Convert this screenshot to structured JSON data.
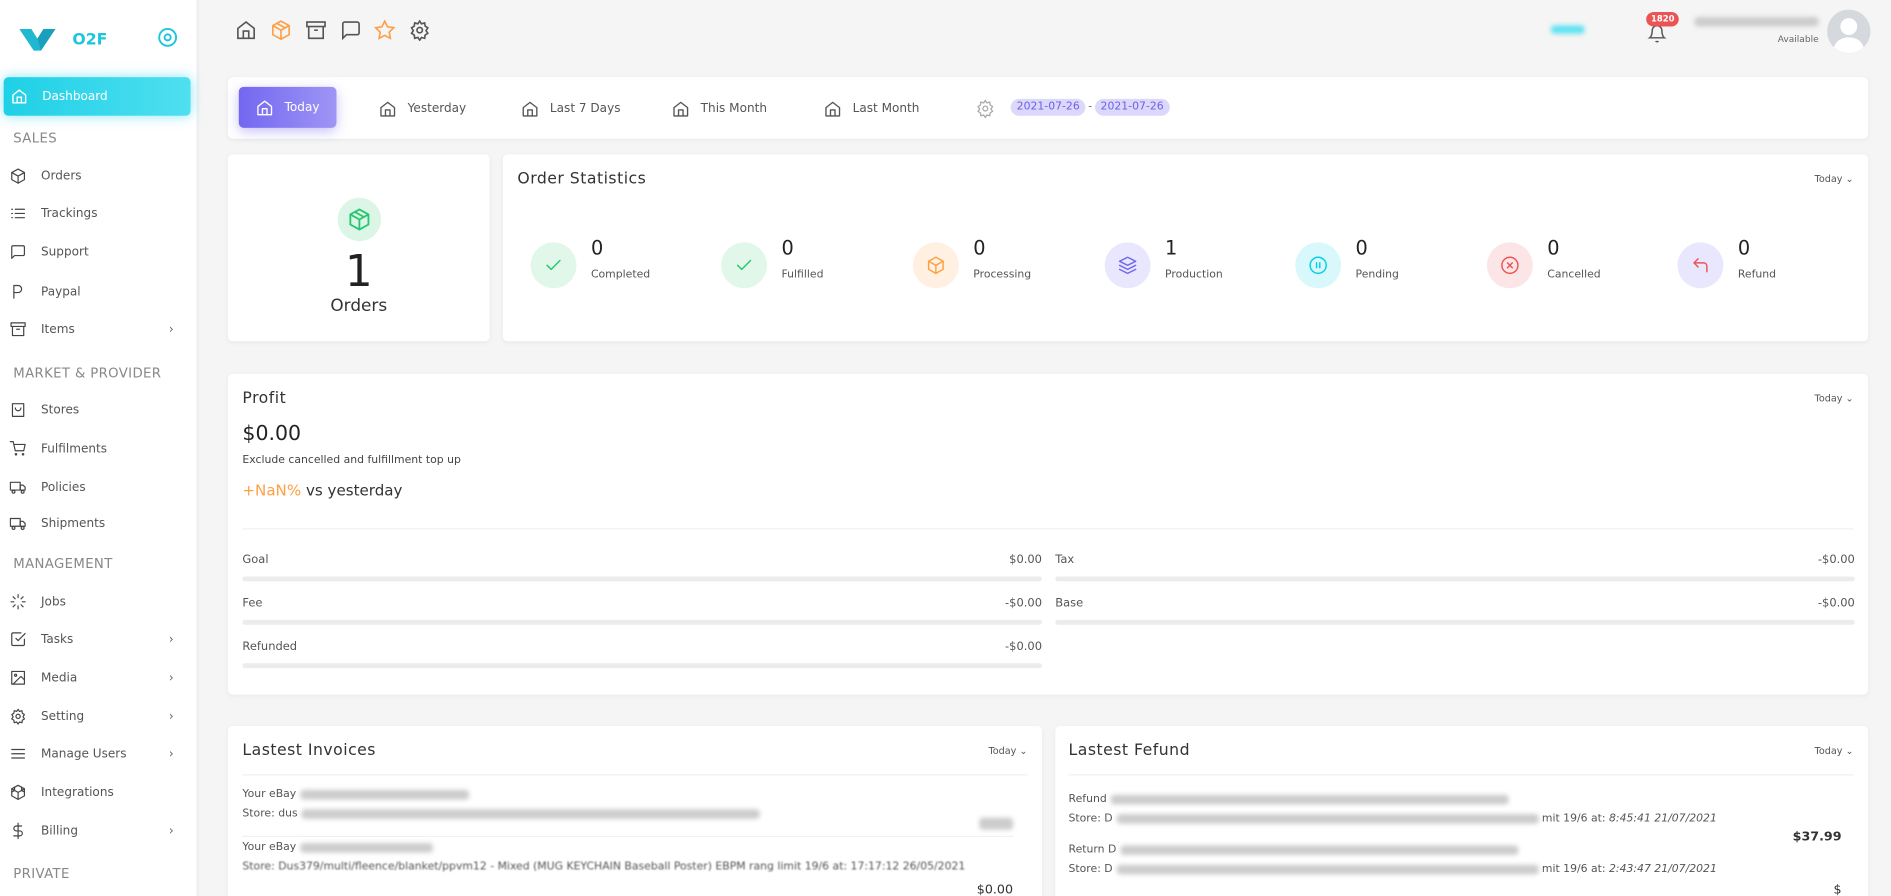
{
  "brand": {
    "name": "O2F",
    "color": "#1ec6dc"
  },
  "sidebar": {
    "active": {
      "label": "Dashboard",
      "icon": "home-icon"
    },
    "sections": [
      {
        "title": "SALES",
        "items": [
          {
            "label": "Orders",
            "icon": "box-icon",
            "chevron": false
          },
          {
            "label": "Trackings",
            "icon": "list-icon",
            "chevron": false
          },
          {
            "label": "Support",
            "icon": "message-icon",
            "chevron": false
          },
          {
            "label": "Paypal",
            "icon": "paypal-icon",
            "chevron": false
          },
          {
            "label": "Items",
            "icon": "archive-icon",
            "chevron": true
          }
        ]
      },
      {
        "title": "MARKET & PROVIDER",
        "items": [
          {
            "label": "Stores",
            "icon": "shopping-bag-icon",
            "chevron": false
          },
          {
            "label": "Fulfilments",
            "icon": "cart-icon",
            "chevron": false
          },
          {
            "label": "Policies",
            "icon": "truck-icon",
            "chevron": false
          },
          {
            "label": "Shipments",
            "icon": "truck-icon",
            "chevron": false
          }
        ]
      },
      {
        "title": "MANAGEMENT",
        "items": [
          {
            "label": "Jobs",
            "icon": "loader-icon",
            "chevron": false
          },
          {
            "label": "Tasks",
            "icon": "check-square-icon",
            "chevron": true
          },
          {
            "label": "Media",
            "icon": "image-icon",
            "chevron": true
          },
          {
            "label": "Setting",
            "icon": "gear-icon",
            "chevron": true
          },
          {
            "label": "Manage Users",
            "icon": "menu-icon",
            "chevron": true
          },
          {
            "label": "Integrations",
            "icon": "codesandbox-icon",
            "chevron": false
          },
          {
            "label": "Billing",
            "icon": "dollar-icon",
            "chevron": true
          }
        ]
      },
      {
        "title": "PRIVATE",
        "items": []
      }
    ]
  },
  "header": {
    "icons": [
      "home-icon",
      "box-icon",
      "archive-icon",
      "message-icon",
      "star-icon",
      "gear-icon"
    ],
    "notification_count": "1820",
    "user_status": "Available"
  },
  "filters": {
    "items": [
      "Today",
      "Yesterday",
      "Last 7 Days",
      "This Month",
      "Last Month"
    ],
    "date_from": "2021-07-26",
    "date_sep": "-",
    "date_to": "2021-07-26",
    "accent": "#7367f0"
  },
  "orders_card": {
    "count": "1",
    "label": "Orders"
  },
  "order_statistics": {
    "title": "Order Statistics",
    "period": "Today ⌄",
    "stats": [
      {
        "value": "0",
        "label": "Completed",
        "icon": "check-icon",
        "color": "#28c76f",
        "bg": "#e0f7ea"
      },
      {
        "value": "0",
        "label": "Fulfilled",
        "icon": "check-icon",
        "color": "#28c76f",
        "bg": "#e0f7ea"
      },
      {
        "value": "0",
        "label": "Processing",
        "icon": "box-icon",
        "color": "#ff9f43",
        "bg": "#fff0e1"
      },
      {
        "value": "1",
        "label": "Production",
        "icon": "layers-icon",
        "color": "#7367f0",
        "bg": "#e9e7fd"
      },
      {
        "value": "0",
        "label": "Pending",
        "icon": "pause-circle-icon",
        "color": "#00cfe8",
        "bg": "#d9f8fc"
      },
      {
        "value": "0",
        "label": "Cancelled",
        "icon": "x-circle-icon",
        "color": "#ea5455",
        "bg": "#fce5e6"
      },
      {
        "value": "0",
        "label": "Refund",
        "icon": "corner-up-left-icon",
        "color": "#ea5455",
        "bg": "#e9e7fd"
      }
    ]
  },
  "profit": {
    "title": "Profit",
    "period": "Today ⌄",
    "amount": "$0.00",
    "note": "Exclude cancelled and fulfillment top up",
    "change": "+NaN%",
    "change_suffix": "vs yesterday",
    "rows_left": [
      {
        "label": "Goal",
        "value": "$0.00"
      },
      {
        "label": "Fee",
        "value": "-$0.00"
      },
      {
        "label": "Refunded",
        "value": "-$0.00"
      }
    ],
    "rows_right": [
      {
        "label": "Tax",
        "value": "-$0.00"
      },
      {
        "label": "Base",
        "value": "-$0.00"
      }
    ]
  },
  "invoices": {
    "title": "Lastest Invoices",
    "period": "Today ⌄",
    "items": [
      {
        "line1": "Your eBay",
        "line2": "Store: dus",
        "amount": ""
      },
      {
        "line1": "Your eBay",
        "line2": "Store: Dus379/multi/fleence/blanket/ppvm12 - Mixed (MUG KEYCHAIN Baseball Poster) EBPM rang limit 19/6 at: 17:17:12 26/05/2021",
        "amount": "$0.00"
      }
    ]
  },
  "refunds": {
    "title": "Lastest Fefund",
    "period": "Today ⌄",
    "items": [
      {
        "line1": "Refund",
        "line2": "Store: D",
        "line2_end": "mit 19/6 at: ",
        "time": "8:45:41 21/07/2021",
        "amount": "$37.99"
      },
      {
        "line1": "Return D",
        "line2": "Store: D",
        "line2_end": "mit 19/6 at: ",
        "time": "2:43:47 21/07/2021",
        "amount": "$"
      }
    ]
  }
}
